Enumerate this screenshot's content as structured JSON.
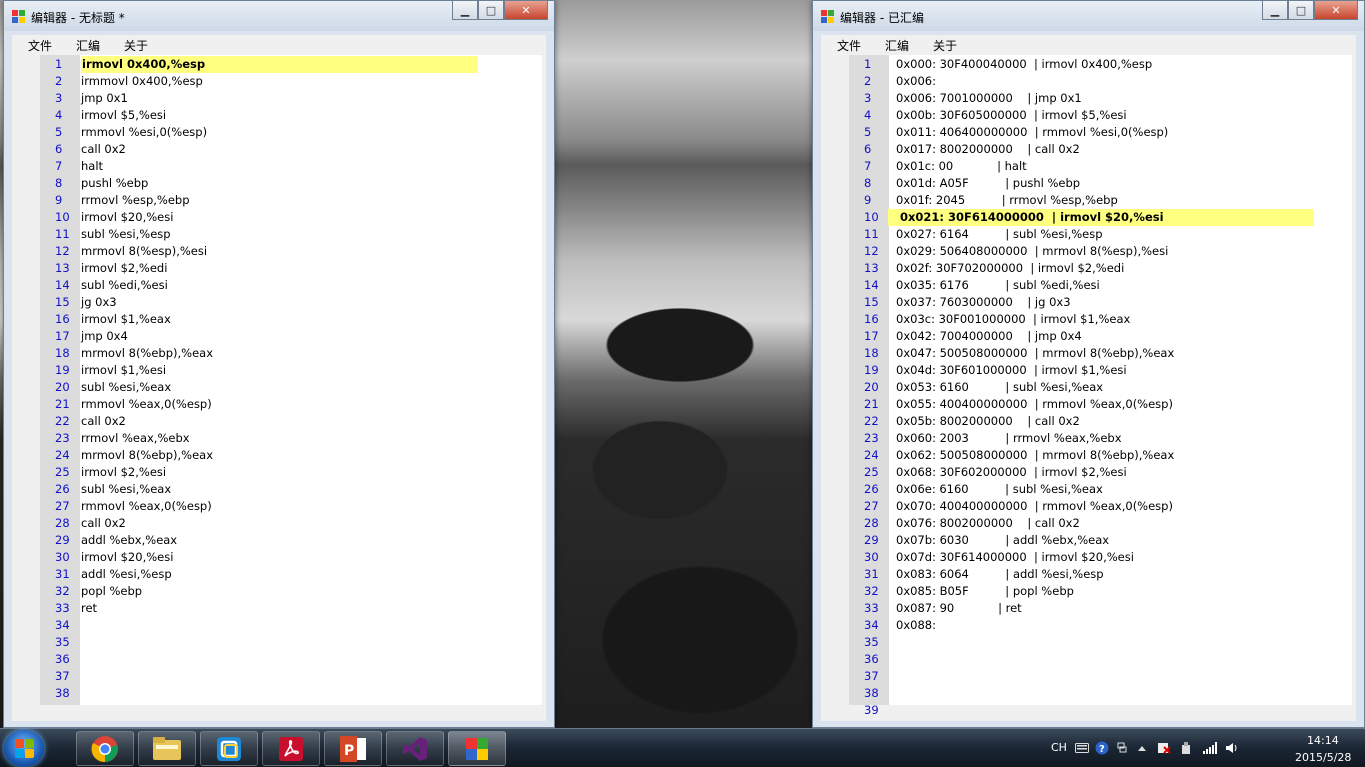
{
  "left_window": {
    "title": "编辑器 - 无标题 *",
    "menu": [
      "文件",
      "汇编",
      "关于"
    ],
    "highlight_line": 1,
    "lines": [
      "irmovl 0x400,%esp",
      "irmmovl 0x400,%esp",
      "jmp 0x1",
      "irmovl $5,%esi",
      "rmmovl %esi,0(%esp)",
      "call 0x2",
      "halt",
      "pushl %ebp",
      "rrmovl %esp,%ebp",
      "irmovl $20,%esi",
      "subl %esi,%esp",
      "mrmovl 8(%esp),%esi",
      "irmovl $2,%edi",
      "subl %edi,%esi",
      "jg 0x3",
      "irmovl $1,%eax",
      "jmp 0x4",
      "mrmovl 8(%ebp),%eax",
      "irmovl $1,%esi",
      "subl %esi,%eax",
      "rmmovl %eax,0(%esp)",
      "call 0x2",
      "rrmovl %eax,%ebx",
      "mrmovl 8(%ebp),%eax",
      "irmovl $2,%esi",
      "subl %esi,%eax",
      "rmmovl %eax,0(%esp)",
      "call 0x2",
      "addl %ebx,%eax",
      "irmovl $20,%esi",
      "addl %esi,%esp",
      "popl %ebp",
      "ret",
      "",
      "",
      "",
      "",
      ""
    ]
  },
  "right_window": {
    "title": "编辑器 - 已汇编",
    "menu": [
      "文件",
      "汇编",
      "关于"
    ],
    "highlight_line": 10,
    "lines": [
      "0x000: 30F400040000  | irmovl 0x400,%esp",
      "0x006:",
      "0x006: 7001000000    | jmp 0x1",
      "0x00b: 30F605000000  | irmovl $5,%esi",
      "0x011: 406400000000  | rmmovl %esi,0(%esp)",
      "0x017: 8002000000    | call 0x2",
      "0x01c: 00            | halt",
      "0x01d: A05F          | pushl %ebp",
      "0x01f: 2045          | rrmovl %esp,%ebp",
      "0x021: 30F614000000  | irmovl $20,%esi",
      "0x027: 6164          | subl %esi,%esp",
      "0x029: 506408000000  | mrmovl 8(%esp),%esi",
      "0x02f: 30F702000000  | irmovl $2,%edi",
      "0x035: 6176          | subl %edi,%esi",
      "0x037: 7603000000    | jg 0x3",
      "0x03c: 30F001000000  | irmovl $1,%eax",
      "0x042: 7004000000    | jmp 0x4",
      "0x047: 500508000000  | mrmovl 8(%ebp),%eax",
      "0x04d: 30F601000000  | irmovl $1,%esi",
      "0x053: 6160          | subl %esi,%eax",
      "0x055: 400400000000  | rmmovl %eax,0(%esp)",
      "0x05b: 8002000000    | call 0x2",
      "0x060: 2003          | rrmovl %eax,%ebx",
      "0x062: 500508000000  | mrmovl 8(%ebp),%eax",
      "0x068: 30F602000000  | irmovl $2,%esi",
      "0x06e: 6160          | subl %esi,%eax",
      "0x070: 400400000000  | rmmovl %eax,0(%esp)",
      "0x076: 8002000000    | call 0x2",
      "0x07b: 6030          | addl %ebx,%eax",
      "0x07d: 30F614000000  | irmovl $20,%esi",
      "0x083: 6064          | addl %esi,%esp",
      "0x085: B05F          | popl %ebp",
      "0x087: 90            | ret",
      "0x088:",
      "",
      "",
      "",
      "",
      ""
    ]
  },
  "window_buttons": {
    "minimize": "▁",
    "maximize": "□",
    "close": "✕"
  },
  "taskbar": {
    "apps": [
      "chrome-icon",
      "file-explorer-icon",
      "virtual-machine-icon",
      "acrobat-icon",
      "powerpoint-icon",
      "visual-studio-icon",
      "editor-app-icon"
    ],
    "tray_lang": "CH",
    "time": "14:14",
    "date": "2015/5/28"
  },
  "colors": {
    "highlight": "#ffff80",
    "line_number": "#1010c8",
    "gutter": "#dcdcdc"
  }
}
